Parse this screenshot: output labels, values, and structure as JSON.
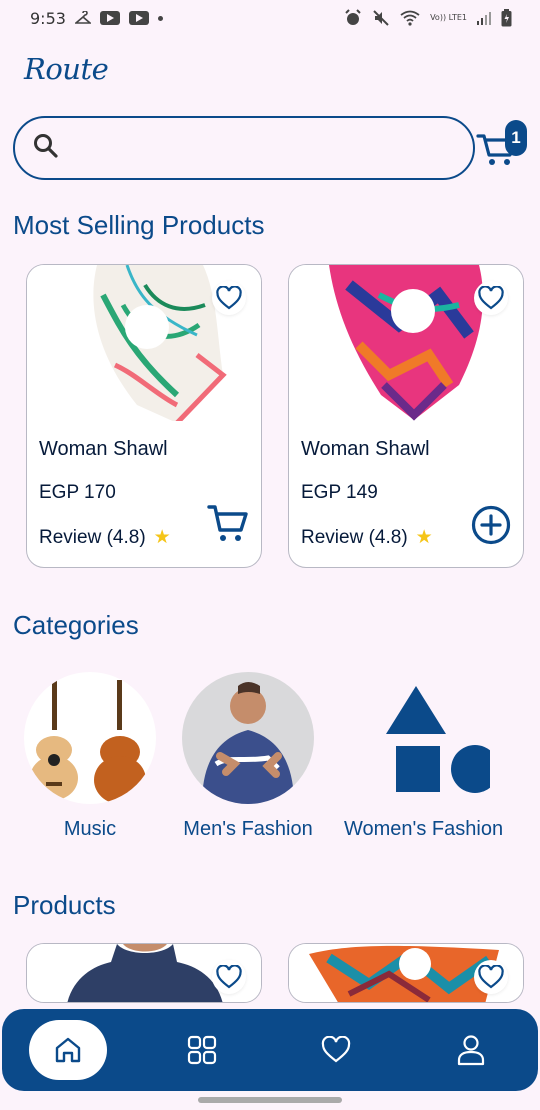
{
  "status": {
    "time": "9:53",
    "network": "Vo)) LTE1"
  },
  "app": {
    "logo": "Route"
  },
  "search": {
    "placeholder": ""
  },
  "cart": {
    "count": "1"
  },
  "sections": {
    "most_selling": "Most Selling Products",
    "categories": "Categories",
    "products": "Products"
  },
  "most_selling": [
    {
      "name": "Woman Shawl",
      "price": "EGP 170",
      "review": "Review (4.8)",
      "action": "cart-icon"
    },
    {
      "name": "Woman Shawl",
      "price": "EGP 149",
      "review": "Review (4.8)",
      "action": "plus-circle-icon"
    }
  ],
  "categories": [
    {
      "label": "Music",
      "icon": "guitar-image"
    },
    {
      "label": "Men's Fashion",
      "icon": "hoodie-image"
    },
    {
      "label": "Women's Fashion",
      "icon": "shapes-icon"
    }
  ],
  "nav": [
    {
      "name": "home",
      "icon": "home-icon",
      "active": true
    },
    {
      "name": "categories",
      "icon": "grid-icon",
      "active": false
    },
    {
      "name": "wishlist",
      "icon": "heart-icon",
      "active": false
    },
    {
      "name": "profile",
      "icon": "user-icon",
      "active": false
    }
  ],
  "colors": {
    "primary": "#0b4a8a",
    "background": "#fcf3fb",
    "star": "#f5c518"
  }
}
